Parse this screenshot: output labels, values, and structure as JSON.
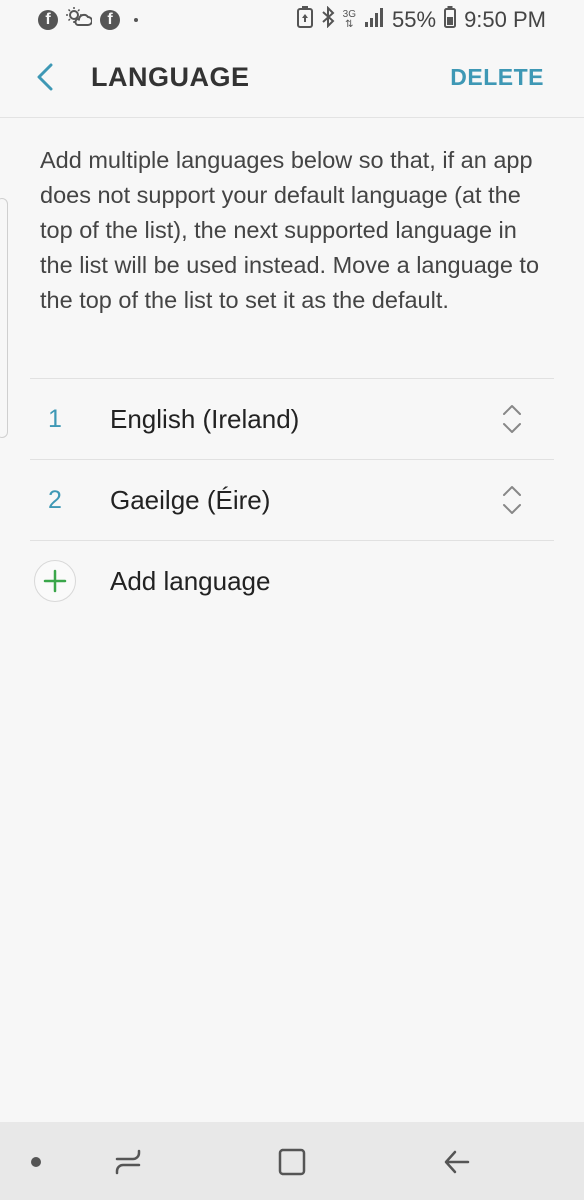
{
  "status_bar": {
    "battery_percent": "55%",
    "time": "9:50 PM",
    "network_type": "3G",
    "icons": [
      "facebook-icon",
      "weather-icon",
      "facebook-icon",
      "notification-dot-icon",
      "battery-saver-icon",
      "bluetooth-icon",
      "network-3g-icon",
      "signal-icon",
      "battery-icon"
    ]
  },
  "header": {
    "title": "LANGUAGE",
    "action_label": "DELETE",
    "back_icon": "chevron-left-icon"
  },
  "description": "Add multiple languages below so that, if an app does not support your default language (at the top of the list), the next supported language in the list will be used instead. Move a language to the top of the list to set it as the default.",
  "languages": [
    {
      "number": "1",
      "name": "English (Ireland)"
    },
    {
      "number": "2",
      "name": "Gaeilge (Éire)"
    }
  ],
  "add_language": {
    "label": "Add language",
    "icon": "plus-icon"
  },
  "colors": {
    "accent": "#3e98b5",
    "add_green": "#3aa64a",
    "background": "#f7f7f7"
  },
  "nav_bar": {
    "buttons": [
      "dot-icon",
      "recent-apps-icon",
      "home-icon",
      "back-arrow-icon"
    ]
  }
}
